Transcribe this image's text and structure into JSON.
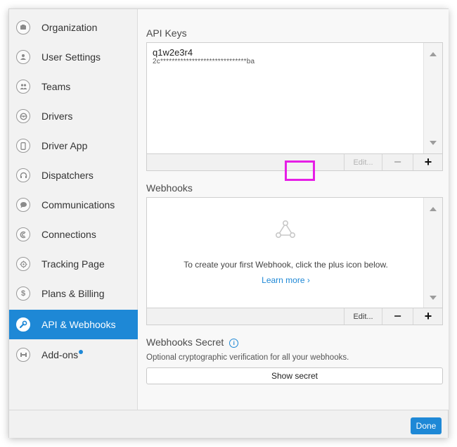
{
  "sidebar": {
    "items": [
      {
        "label": "Organization",
        "icon": "organization-icon"
      },
      {
        "label": "User Settings",
        "icon": "user-icon"
      },
      {
        "label": "Teams",
        "icon": "teams-icon"
      },
      {
        "label": "Drivers",
        "icon": "steering-wheel-icon"
      },
      {
        "label": "Driver App",
        "icon": "phone-icon"
      },
      {
        "label": "Dispatchers",
        "icon": "headset-icon"
      },
      {
        "label": "Communications",
        "icon": "chat-icon"
      },
      {
        "label": "Connections",
        "icon": "connections-icon"
      },
      {
        "label": "Tracking Page",
        "icon": "tracking-icon"
      },
      {
        "label": "Plans & Billing",
        "icon": "dollar-icon"
      },
      {
        "label": "API & Webhooks",
        "icon": "wrench-icon",
        "active": true
      },
      {
        "label": "Add-ons",
        "icon": "addons-icon",
        "badge_dot": true
      }
    ]
  },
  "api_keys": {
    "title": "API Keys",
    "keys": [
      {
        "name": "q1w2e3r4",
        "value": "2c******************************ba"
      }
    ],
    "toolbar": {
      "edit": "Edit...",
      "minus": "−",
      "plus": "+"
    }
  },
  "webhooks": {
    "title": "Webhooks",
    "empty_message": "To create your first Webhook, click the plus icon below.",
    "learn_more": "Learn more ›",
    "toolbar": {
      "edit": "Edit...",
      "minus": "−",
      "plus": "+"
    }
  },
  "webhooks_secret": {
    "title": "Webhooks Secret",
    "info_glyph": "i",
    "description": "Optional cryptographic verification for all your webhooks.",
    "button": "Show secret"
  },
  "footer": {
    "done": "Done"
  },
  "colors": {
    "accent": "#1e88d6",
    "highlight": "#e61ee6"
  }
}
